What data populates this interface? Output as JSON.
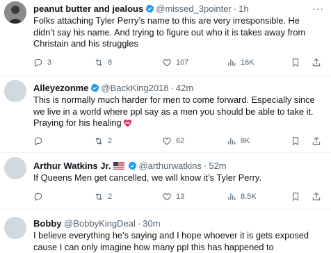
{
  "tweets": [
    {
      "name": "peanut butter and jealous",
      "handle": "@missed_3pointer",
      "time": "1h",
      "text": "Folks attaching Tyler Perry’s name to this are very irresponsible. He didn’t say his name. And trying to figure out who it is takes away from Christain and his struggles",
      "verified": true,
      "replies": "3",
      "reposts": "8",
      "likes": "107",
      "views": "16K"
    },
    {
      "name": "Alleyezonme",
      "handle": "@BackKing2018",
      "time": "42m",
      "text": "This is normally much harder  for men to come forward. Especially since we live in a world where ppl say as a men you should be able to take it. Praying for his healing",
      "verified": true,
      "replies": "",
      "reposts": "2",
      "likes": "62",
      "views": "8K"
    },
    {
      "name": "Arthur Watkins Jr.",
      "handle": "@arthurwatkins",
      "time": "52m",
      "text": "If Queens Men get cancelled, we will know it’s Tyler Perry.",
      "verified": true,
      "replies": "",
      "reposts": "2",
      "likes": "13",
      "views": "8.5K"
    },
    {
      "name": "Bobby",
      "handle": "@BobbyKingDeal",
      "time": "30m",
      "text": "I believe everything he’s saying and I hope whoever it is gets exposed cause I can only imagine how many ppl this has happened to",
      "verified": false
    }
  ],
  "separator": "·",
  "more_label": "···",
  "colors": {
    "verified": "#1d9bf0",
    "secondary": "#536471",
    "divider": "#eff3f4"
  }
}
